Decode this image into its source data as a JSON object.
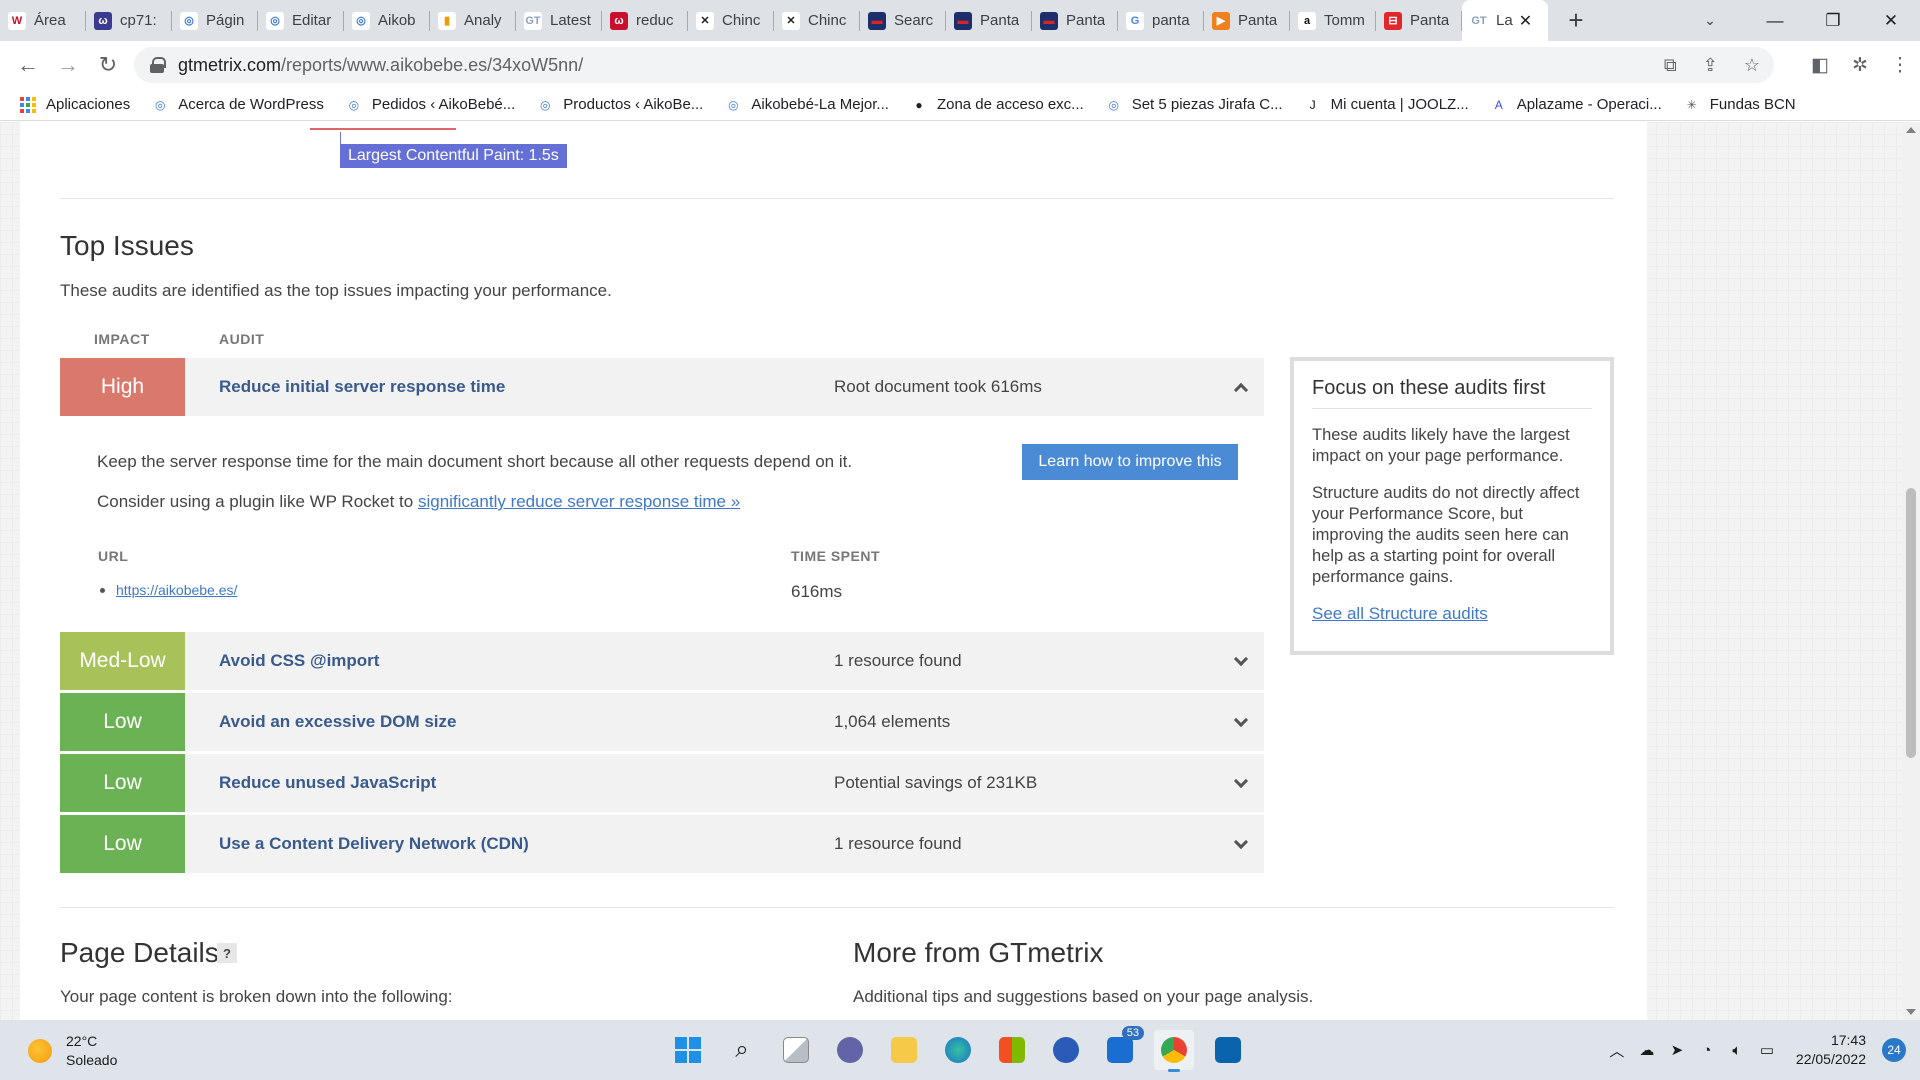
{
  "browser": {
    "tabs": [
      {
        "title": "Área",
        "fav_color": "#ffffff",
        "fav_text": "W",
        "fav_text_color": "#c8102e"
      },
      {
        "title": "cp71:",
        "fav_color": "#3b3b8f",
        "fav_text": "ω",
        "fav_text_color": "#ffffff"
      },
      {
        "title": "Págin",
        "fav_color": "#ffffff",
        "fav_text": "◎",
        "fav_text_color": "#3a78d6"
      },
      {
        "title": "Editar",
        "fav_color": "#ffffff",
        "fav_text": "◎",
        "fav_text_color": "#3a78d6"
      },
      {
        "title": "Aikob",
        "fav_color": "#ffffff",
        "fav_text": "◎",
        "fav_text_color": "#3a78d6"
      },
      {
        "title": "Analy",
        "fav_color": "#ffffff",
        "fav_text": "▮",
        "fav_text_color": "#f29900"
      },
      {
        "title": "Latest",
        "fav_color": "#ffffff",
        "fav_text": "GT",
        "fav_text_color": "#8aa0bd"
      },
      {
        "title": "reduc",
        "fav_color": "#c8102e",
        "fav_text": "ω",
        "fav_text_color": "#ffffff"
      },
      {
        "title": "Chinc",
        "fav_color": "#ffffff",
        "fav_text": "✕",
        "fav_text_color": "#222222"
      },
      {
        "title": "Chinc",
        "fav_color": "#ffffff",
        "fav_text": "✕",
        "fav_text_color": "#222222"
      },
      {
        "title": "Searc",
        "fav_color": "#1c2f6b",
        "fav_text": "▬",
        "fav_text_color": "#d8242a"
      },
      {
        "title": "Panta",
        "fav_color": "#1c2f6b",
        "fav_text": "▬",
        "fav_text_color": "#d8242a"
      },
      {
        "title": "Panta",
        "fav_color": "#1c2f6b",
        "fav_text": "▬",
        "fav_text_color": "#d8242a"
      },
      {
        "title": "panta",
        "fav_color": "#ffffff",
        "fav_text": "G",
        "fav_text_color": "#4285f4"
      },
      {
        "title": "Panta",
        "fav_color": "#f07f1d",
        "fav_text": "▶",
        "fav_text_color": "#ffffff"
      },
      {
        "title": "Tomm",
        "fav_color": "#ffffff",
        "fav_text": "a",
        "fav_text_color": "#111111"
      },
      {
        "title": "Panta",
        "fav_color": "#e1262c",
        "fav_text": "⊟",
        "fav_text_color": "#ffffff"
      },
      {
        "title": "La",
        "fav_color": "#ffffff",
        "fav_text": "GT",
        "fav_text_color": "#8aa0bd",
        "active": true
      }
    ],
    "url_host": "gtmetrix.com",
    "url_path": "/reports/www.aikobebe.es/34xoW5nn/",
    "bookmarks": [
      {
        "label": "Aplicaciones",
        "icon": "apps-grid-icon"
      },
      {
        "label": "Acerca de WordPress",
        "icon": "wordpress-icon"
      },
      {
        "label": "Pedidos ‹ AikoBebé...",
        "icon": "wordpress-icon"
      },
      {
        "label": "Productos ‹ AikoBe...",
        "icon": "wordpress-icon"
      },
      {
        "label": "Aikobebé-La Mejor...",
        "icon": "wordpress-icon"
      },
      {
        "label": "Zona de acceso exc...",
        "icon": "globe-icon"
      },
      {
        "label": "Set 5 piezas Jirafa C...",
        "icon": "wordpress-icon"
      },
      {
        "label": "Mi cuenta | JOOLZ...",
        "icon": "joolz-icon"
      },
      {
        "label": "Aplazame - Operaci...",
        "icon": "aplazame-icon"
      },
      {
        "label": "Fundas BCN",
        "icon": "asterisk-icon"
      }
    ]
  },
  "page": {
    "lcp_label": "Largest Contentful Paint: 1.5s",
    "top_issues": {
      "title": "Top Issues",
      "desc": "These audits are identified as the top issues impacting your performance.",
      "col_impact": "IMPACT",
      "col_audit": "AUDIT",
      "items": [
        {
          "impact": "High",
          "color": "#d9796c",
          "audit": "Reduce initial server response time",
          "value": "Root document took 616ms",
          "expanded": true
        },
        {
          "impact": "Med-Low",
          "color": "#a8c25a",
          "audit": "Avoid CSS @import",
          "value": "1 resource found"
        },
        {
          "impact": "Low",
          "color": "#6bb255",
          "audit": "Avoid an excessive DOM size",
          "value": "1,064 elements"
        },
        {
          "impact": "Low",
          "color": "#6bb255",
          "audit": "Reduce unused JavaScript",
          "value": "Potential savings of 231KB"
        },
        {
          "impact": "Low",
          "color": "#6bb255",
          "audit": "Use a Content Delivery Network (CDN)",
          "value": "1 resource found"
        }
      ],
      "detail": {
        "line1": "Keep the server response time for the main document short because all other requests depend on it.",
        "line2_prefix": "Consider using a plugin like WP Rocket to ",
        "line2_link": "significantly reduce server response time »",
        "learn_button": "Learn how to improve this",
        "col_url": "URL",
        "col_time": "TIME SPENT",
        "url": "https://aikobebe.es/",
        "time": "616ms"
      }
    },
    "focus": {
      "title": "Focus on these audits first",
      "p1": "These audits likely have the largest impact on your page performance.",
      "p2": "Structure audits do not directly affect your Performance Score, but improving the audits seen here can help as a starting point for overall performance gains.",
      "link": "See all Structure audits"
    },
    "page_details": {
      "title": "Page Details",
      "help": "?",
      "desc": "Your page content is broken down into the following:"
    },
    "more": {
      "title": "More from GTmetrix",
      "desc": "Additional tips and suggestions based on your page analysis."
    }
  },
  "taskbar": {
    "temp": "22°C",
    "weather": "Soleado",
    "time": "17:43",
    "date": "22/05/2022",
    "notifications": "24",
    "mail_badge": "53"
  }
}
